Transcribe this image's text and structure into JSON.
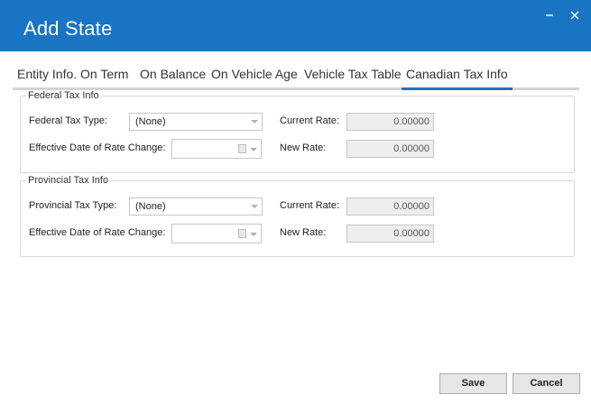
{
  "window": {
    "title": "Add State",
    "minimize_icon": "minimize-icon",
    "close_icon": "close-icon"
  },
  "tabs": [
    {
      "label": "Entity Info."
    },
    {
      "label": "On Term"
    },
    {
      "label": "On Balance"
    },
    {
      "label": "On Vehicle Age"
    },
    {
      "label": "Vehicle Tax Table"
    },
    {
      "label": "Canadian Tax Info",
      "active": true
    }
  ],
  "federal": {
    "legend": "Federal Tax Info",
    "tax_type_label": "Federal Tax Type:",
    "tax_type_value": "(None)",
    "current_rate_label": "Current Rate:",
    "current_rate_value": "0.00000",
    "effective_date_label": "Effective Date of Rate Change:",
    "effective_date_value": "",
    "new_rate_label": "New Rate:",
    "new_rate_value": "0.00000"
  },
  "provincial": {
    "legend": "Provincial Tax Info",
    "tax_type_label": "Provincial Tax Type:",
    "tax_type_value": "(None)",
    "current_rate_label": "Current Rate:",
    "current_rate_value": "0.00000",
    "effective_date_label": "Effective Date of Rate Change:",
    "effective_date_value": "",
    "new_rate_label": "New Rate:",
    "new_rate_value": "0.00000"
  },
  "buttons": {
    "save": "Save",
    "cancel": "Cancel"
  },
  "colors": {
    "titlebar": "#1a74c4",
    "active_tab_underline": "#1a74c4"
  }
}
